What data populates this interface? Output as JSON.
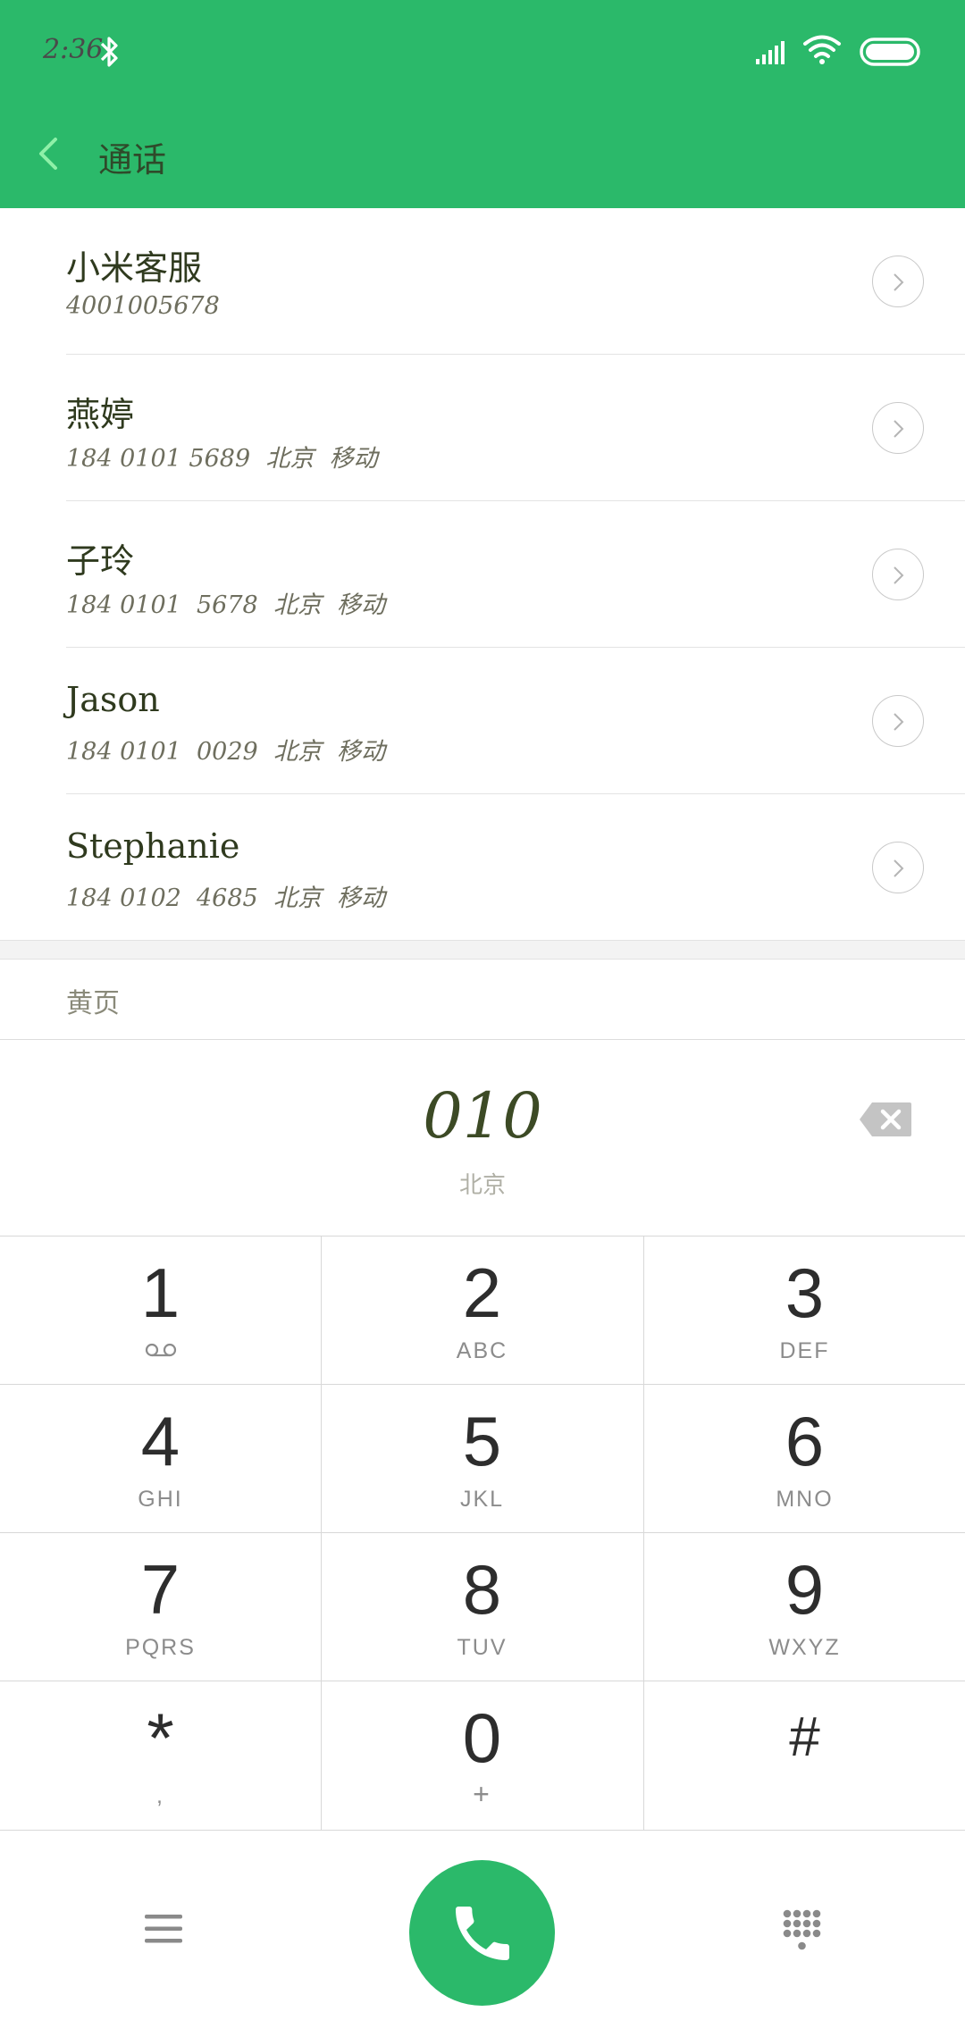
{
  "status_bar": {
    "time": "2:36"
  },
  "header": {
    "title": "通话"
  },
  "calls": [
    {
      "name": "小米客服",
      "detail": "4001005678"
    },
    {
      "name": "燕婷",
      "detail": "184 0101 5689  北京  移动"
    },
    {
      "name": "子玲",
      "detail": "184 0101  5678  北京  移动"
    },
    {
      "name": "Jason",
      "detail": "184 0101  0029  北京  移动"
    },
    {
      "name": "Stephanie",
      "detail": "184 0102  4685  北京  移动"
    }
  ],
  "yellow_pages": "黄页",
  "input": {
    "number": "010",
    "location": "北京"
  },
  "keypad": [
    {
      "digit": "1",
      "sub": ""
    },
    {
      "digit": "2",
      "sub": "ABC"
    },
    {
      "digit": "3",
      "sub": "DEF"
    },
    {
      "digit": "4",
      "sub": "GHI"
    },
    {
      "digit": "5",
      "sub": "JKL"
    },
    {
      "digit": "6",
      "sub": "MNO"
    },
    {
      "digit": "7",
      "sub": "PQRS"
    },
    {
      "digit": "8",
      "sub": "TUV"
    },
    {
      "digit": "9",
      "sub": "WXYZ"
    },
    {
      "digit": "*",
      "sub": ","
    },
    {
      "digit": "0",
      "sub": "+"
    },
    {
      "digit": "#",
      "sub": ""
    }
  ],
  "icons": {
    "status": [
      "bluetooth-icon",
      "signal-icon",
      "wifi-icon",
      "battery-icon"
    ],
    "back": "back-arrow-icon",
    "detail": "chevron-right-circle-icon",
    "backspace": "backspace-icon",
    "voicemail": "voicemail-icon",
    "menu": "menu-icon",
    "call": "phone-icon",
    "dialpad": "dialpad-icon"
  },
  "colors": {
    "accent": "#2bb96a",
    "back_arrow": "#8ef0a8"
  }
}
